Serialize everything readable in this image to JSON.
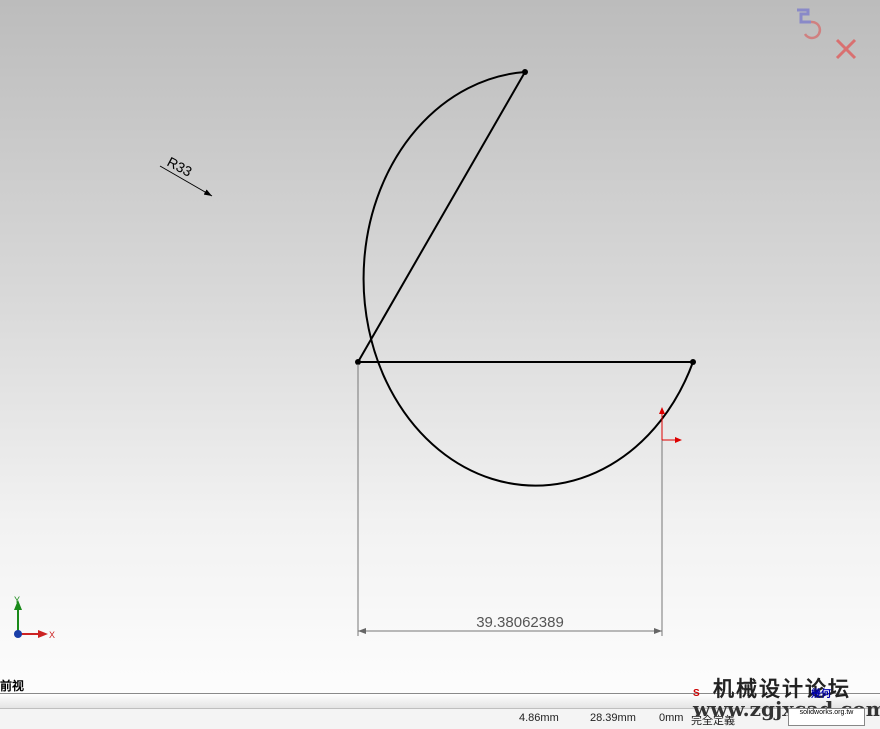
{
  "sketch": {
    "radius_label": "R33",
    "dimension_value": "39.38062389"
  },
  "view": {
    "label": "前视"
  },
  "statusbar": {
    "x_coord": "4.86mm",
    "y_coord": "28.39mm",
    "z_coord": "0mm",
    "state": "完全定義"
  },
  "triad": {
    "x_label": "X",
    "y_label": "Y"
  },
  "watermark": {
    "title": "机械设计论坛",
    "url": "www.zgjxcad.com",
    "badge": "solidworks.org.tw",
    "red_text": "S",
    "blue_text": "幾何"
  },
  "confirm_corner": {
    "ok_icon": "rebuild-check-icon",
    "cancel_icon": "close-x-icon"
  }
}
